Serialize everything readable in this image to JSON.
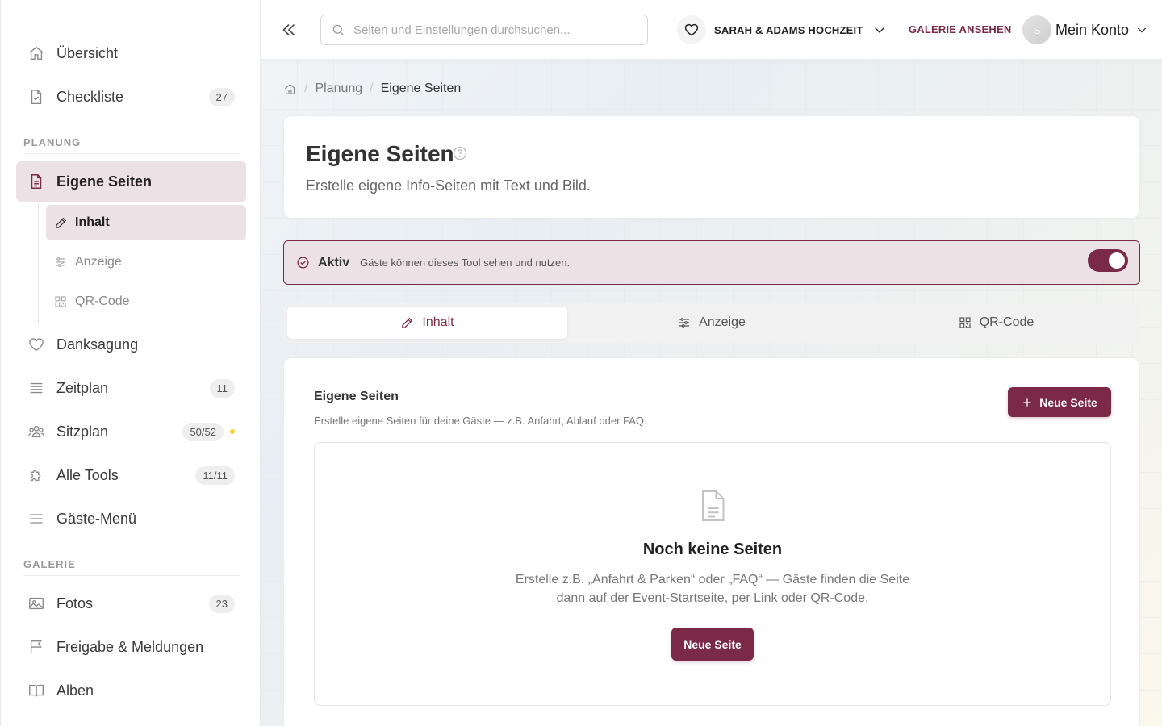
{
  "sidebar": {
    "items": [
      {
        "label": "Übersicht",
        "icon": "home-icon"
      },
      {
        "label": "Checkliste",
        "badge": "27",
        "icon": "checklist-icon"
      }
    ],
    "section_planung": "PLANUNG",
    "eigene_seiten": {
      "label": "Eigene Seiten",
      "icon": "page-icon",
      "active": true
    },
    "sub_items": [
      {
        "label": "Inhalt",
        "icon": "edit-icon",
        "active": true
      },
      {
        "label": "Anzeige",
        "icon": "sliders-icon"
      },
      {
        "label": "QR-Code",
        "icon": "qr-code-icon"
      }
    ],
    "planung_items": [
      {
        "label": "Danksagung",
        "icon": "heart-icon"
      },
      {
        "label": "Zeitplan",
        "badge": "11",
        "icon": "list-icon"
      },
      {
        "label": "Sitzplan",
        "badge": "50/52",
        "icon": "users-icon",
        "dot_color": "#f3d42f"
      },
      {
        "label": "Alle Tools",
        "badge": "11/11",
        "icon": "puzzle-icon"
      },
      {
        "label": "Gäste-Menü",
        "icon": "menu-icon"
      }
    ],
    "section_galerie": "GALERIE",
    "galerie_items": [
      {
        "label": "Fotos",
        "badge": "23",
        "icon": "image-icon"
      },
      {
        "label": "Freigabe & Meldungen",
        "icon": "flag-icon"
      },
      {
        "label": "Alben",
        "icon": "book-icon"
      }
    ]
  },
  "topbar": {
    "search_placeholder": "Seiten und Einstellungen durchsuchen...",
    "event_name": "SARAH & ADAMS HOCHZEIT",
    "gallery_link": "GALERIE ANSEHEN",
    "avatar_initial": "S",
    "account_label": "Mein Konto"
  },
  "breadcrumb": {
    "parent": "Planung",
    "current": "Eigene Seiten"
  },
  "header": {
    "title": "Eigene Seiten",
    "subtitle": "Erstelle eigene Info-Seiten mit Text und Bild."
  },
  "status": {
    "title": "Aktiv",
    "description": "Gäste können dieses Tool sehen und nutzen.",
    "enabled": true
  },
  "tabs": [
    {
      "label": "Inhalt",
      "icon": "edit-icon",
      "active": true
    },
    {
      "label": "Anzeige",
      "icon": "sliders-icon"
    },
    {
      "label": "QR-Code",
      "icon": "qr-code-icon"
    }
  ],
  "content": {
    "title": "Eigene Seiten",
    "subtitle": "Erstelle eigene Seiten für deine Gäste — z.B. Anfahrt, Ablauf oder FAQ.",
    "new_button": "Neue Seite",
    "empty_title": "Noch keine Seiten",
    "empty_text_1": "Erstelle z.B. „Anfahrt & Parken“ oder „FAQ“ — Gäste finden die Seite",
    "empty_text_2": "dann auf der Event-Startseite, per Link oder QR-Code.",
    "empty_button": "Neue Seite"
  },
  "colors": {
    "accent": "#7a2946",
    "accent_light": "#ece1e5",
    "warning_dot": "#f3d42f"
  }
}
